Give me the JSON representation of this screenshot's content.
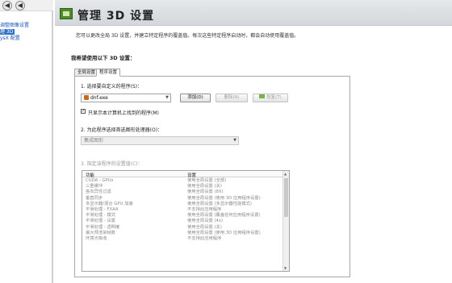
{
  "nav": {
    "back_glyph": "◀",
    "forward_glyph": "◀"
  },
  "left_pane": {
    "items": [
      {
        "label": "调整图像设置"
      },
      {
        "label": "理 3D"
      },
      {
        "label": "ysX 配置"
      }
    ],
    "top_fragment": "选"
  },
  "header": {
    "title": "管理 3D 设置",
    "icon": "nvidia-3d-icon"
  },
  "description": "您可以更改全局 3D 设置，并建立特定程序的覆盖值。每次这些特定程序启动时，都会自动使用覆盖值。",
  "section_title": "我希望使用以下 3D 设置：",
  "tabs": [
    {
      "label": "全局设置",
      "active": false
    },
    {
      "label": "程序设置",
      "active": true
    }
  ],
  "step1": {
    "label": "1. 选择要自定义的程序(S)：",
    "selected_program": "dnf.exe",
    "add_button": "添加(D)",
    "delete_button": "删除(R)",
    "restore_button": "恢复(T)",
    "checkbox_label": "只显示本计算机上找到的程序(M)",
    "checkbox_checked": true
  },
  "step2": {
    "label": "2. 为此程序选择首选图形处理器(O)：",
    "selected_processor": "集成图形"
  },
  "step3": {
    "label": "3. 指定该程序的设置值(C)：",
    "columns": [
      "功能",
      "设置"
    ],
    "rows": [
      {
        "feature": "CUDA - GPUs",
        "setting": "使用全局设置 (全部)"
      },
      {
        "feature": "三重缓冲",
        "setting": "使用全局设置 (关)"
      },
      {
        "feature": "各向异性过滤",
        "setting": "使用全局设置 (8X)"
      },
      {
        "feature": "垂直同步",
        "setting": "使用全局设置 (使用 3D 应用程序设置)"
      },
      {
        "feature": "多显示器/混合 GPU 加速",
        "setting": "使用全局设置 (多显示器性能模式)"
      },
      {
        "feature": "平滑处理 - FXAA",
        "setting": "不支持此应用程序"
      },
      {
        "feature": "平滑处理 - 模式",
        "setting": "使用全局设置 (覆盖任何应用程序设置)"
      },
      {
        "feature": "平滑处理 - 设置",
        "setting": "使用全局设置 (4x)"
      },
      {
        "feature": "平滑处理 - 透明度",
        "setting": "使用全局设置 (关)"
      },
      {
        "feature": "最大预渲染帧数",
        "setting": "使用全局设置 (使用 3D 应用程序设置)"
      },
      {
        "feature": "环境光吸收",
        "setting": "不支持此应用程序"
      }
    ]
  },
  "colors": {
    "link": "#1a55b8",
    "selected": "#3170c8",
    "header_bg": "#dcdfe2"
  }
}
